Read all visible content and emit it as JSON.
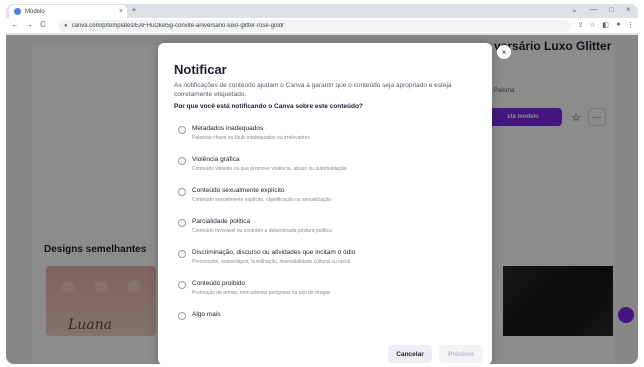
{
  "browser": {
    "tab_title": "Modelo",
    "tab_close": "×",
    "new_tab": "+",
    "url": "canva.com/p/templates/EAFHuDkel5g-convite-aniversario-luxo-glitter-rose-gold/",
    "back": "←",
    "forward": "→",
    "reload": "C",
    "window_min": "⌄",
    "window_dash": "—",
    "window_max": "□",
    "window_close": "×",
    "share_icon": "⇪",
    "bookmark_icon": "☆",
    "sidepanel_icon": "◧",
    "profile_icon": "●",
    "menu_icon": "⋮"
  },
  "background": {
    "template_title": "versário Luxo Glitter",
    "author": "Paloma",
    "cta_label": "sta modelo",
    "star": "☆",
    "more": "···",
    "similar_heading": "Designs semelhantes",
    "thumb_text": "Luana",
    "next_arrow": "›"
  },
  "modal": {
    "close": "×",
    "title": "Notificar",
    "description": "As notificações de conteúdo ajudam o Canva a garantir que o conteúdo seja apropriado e esteja corretamente etiquetado.",
    "question": "Por que você está notificando o Canva sobre este conteúdo?",
    "options": [
      {
        "label": "Metadados inadequados",
        "sub": "Palavras-chave ou título inadequados ou irrelevantes"
      },
      {
        "label": "Violência gráfica",
        "sub": "Conteúdo violento ou que promove violência, abuso ou automutilação"
      },
      {
        "label": "Conteúdo sexualmente explícito",
        "sub": "Conteúdo sexualmente explícito, objetificação ou sexualização"
      },
      {
        "label": "Parcialidade política",
        "sub": "Conteúdo favorável ou contrário a determinada postura política"
      },
      {
        "label": "Discriminação, discurso ou atividades que incitam o ódio",
        "sub": "Preconceito, estereótipos, humilhação, insensibilidade cultural ou racial"
      },
      {
        "label": "Conteúdo proibido",
        "sub": "Promoção de armas, mercadorias perigosas ou uso de drogas"
      },
      {
        "label": "Algo mais",
        "sub": ""
      }
    ],
    "cancel_label": "Cancelar",
    "next_label": "Próximo"
  },
  "colors": {
    "accent": "#7d2ae8"
  }
}
